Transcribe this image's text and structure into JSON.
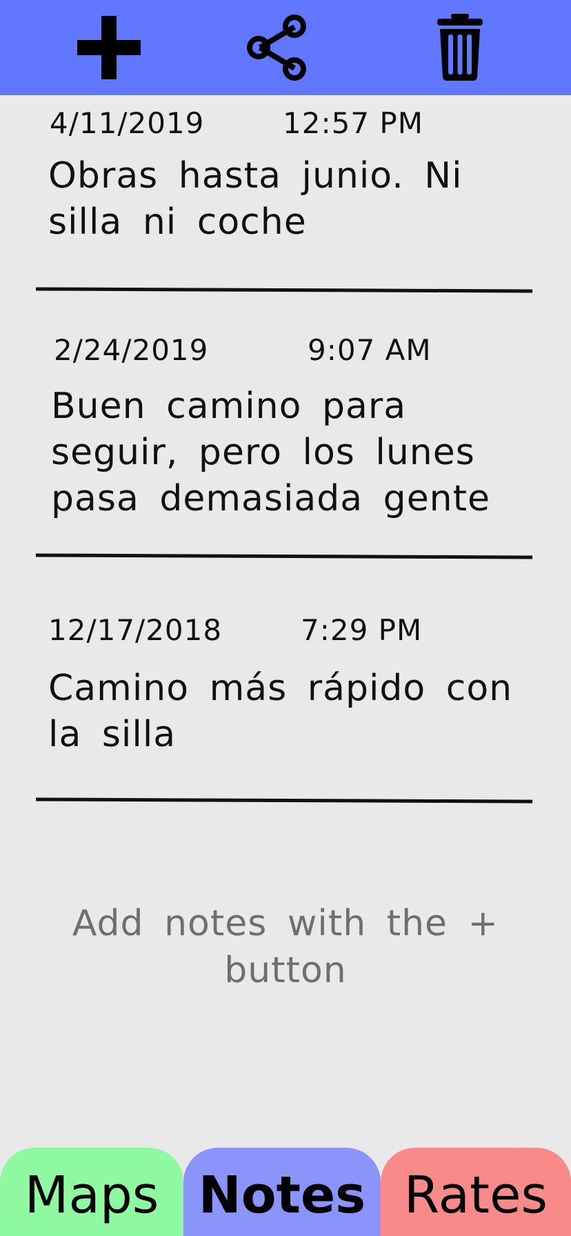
{
  "toolbar": {
    "background": "#6277ff",
    "add_icon": "plus-icon",
    "share_icon": "share-icon",
    "delete_icon": "trash-icon"
  },
  "notes": [
    {
      "date": "4/11/2019",
      "time": "12:57  PM",
      "text": "Obras hasta junio. Ni silla ni coche"
    },
    {
      "date": "2/24/2019",
      "time": "9:07  AM",
      "text": "Buen camino para seguir, pero los lunes pasa demasiada gente c..."
    },
    {
      "date": "12/17/2018",
      "time": "7:29  PM",
      "text": "Camino más rápido con la silla"
    }
  ],
  "empty_hint": "Add notes with the + button",
  "tabs": {
    "maps": {
      "label": "Maps",
      "color": "#8ff9a2"
    },
    "notes": {
      "label": "Notes",
      "color": "#8a94fb",
      "active": true
    },
    "rates": {
      "label": "Rates",
      "color": "#f88a8a"
    }
  }
}
